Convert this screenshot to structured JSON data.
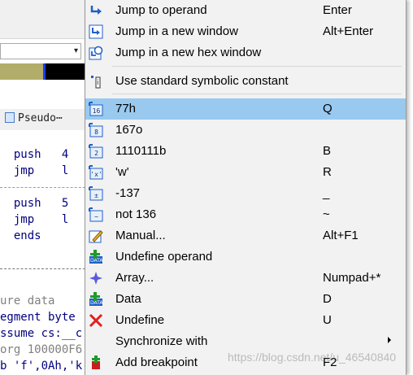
{
  "background": {
    "combo_arrow": "▾",
    "tab_label": "Pseudo⋯",
    "code_lines": [
      {
        "text": "  push   4",
        "cls": "kw"
      },
      {
        "text": "  jmp    l",
        "cls": "kw"
      },
      {
        "text": "  push   5",
        "cls": "kw"
      },
      {
        "text": "  jmp    l",
        "cls": "kw"
      },
      {
        "text": "  ends",
        "cls": "kw"
      },
      {
        "text": "ure data",
        "cls": "cm"
      },
      {
        "text": "egment byte",
        "cls": "kw"
      },
      {
        "text": "ssume cs:__c",
        "cls": "kw"
      },
      {
        "text": "org 100000F6",
        "cls": "cm"
      },
      {
        "text": "b 'f',0Ah,'k",
        "cls": "kw"
      }
    ]
  },
  "menu": {
    "items": [
      {
        "label": "Jump to operand",
        "key": "Enter",
        "icon": "jump-arrow-icon"
      },
      {
        "label": "Jump in a new window",
        "key": "Alt+Enter",
        "icon": "jump-new-window-icon"
      },
      {
        "label": "Jump in a new hex window",
        "key": "",
        "icon": "hex-window-icon"
      },
      {
        "label": "Use standard symbolic constant",
        "key": "",
        "icon": "symbolic-constant-icon"
      },
      {
        "label": "77h",
        "key": "Q",
        "icon": "hex-base-icon",
        "badge": "16"
      },
      {
        "label": "167o",
        "key": "",
        "icon": "octal-base-icon",
        "badge": "8"
      },
      {
        "label": "1110111b",
        "key": "B",
        "icon": "binary-base-icon",
        "badge": "2"
      },
      {
        "label": "'w'",
        "key": "R",
        "icon": "char-icon",
        "badge": "'x'"
      },
      {
        "label": "-137",
        "key": "_",
        "icon": "negate-icon",
        "badge": "±"
      },
      {
        "label": "not 136",
        "key": "~",
        "icon": "bitwise-not-icon",
        "badge": "~"
      },
      {
        "label": "Manual...",
        "key": "Alt+F1",
        "icon": "pencil-icon"
      },
      {
        "label": "Undefine operand",
        "key": "",
        "icon": "undefine-operand-icon"
      },
      {
        "label": "Array...",
        "key": "Numpad+*",
        "icon": "array-icon"
      },
      {
        "label": "Data",
        "key": "D",
        "icon": "data-icon"
      },
      {
        "label": "Undefine",
        "key": "U",
        "icon": "red-x-icon"
      },
      {
        "label": "Synchronize with",
        "key": "",
        "icon": "",
        "submenu": true
      },
      {
        "label": "Add breakpoint",
        "key": "F2",
        "icon": "breakpoint-icon"
      }
    ],
    "highlighted_index": 4
  },
  "watermark": "https://blog.csdn.net/u_46540840",
  "colors": {
    "highlight": "#99c9ef",
    "menu_bg": "#f2f2f2",
    "icon_blue": "#1e5fc8",
    "code_keyword": "#000080"
  }
}
